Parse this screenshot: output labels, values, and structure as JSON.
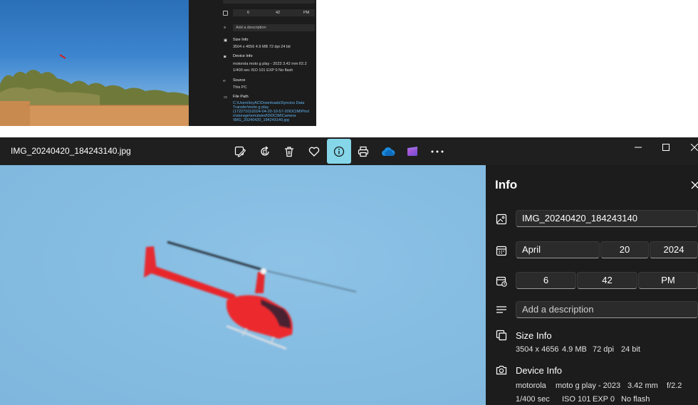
{
  "thumbnail": {
    "time_hour": "6",
    "time_minute": "42",
    "time_ampm": "PM",
    "description_placeholder": "Add a description",
    "size_info_label": "Size Info",
    "size_info_values": "3504 x 4656    4.9 MB    72 dpi    24 bit",
    "device_info_label": "Device Info",
    "device_line1": "motorola    moto g play - 2023    3.42 mm    f/2.2",
    "device_line2": "1/400 sec    ISO 101    EXP 0    No flash",
    "source_label": "Source",
    "source_value": "This PC",
    "file_path_label": "File Path",
    "file_path_line1": "C:\\Users\\loyAC\\Downloads\\Syncios Data",
    "file_path_line2": "Transfer\\moto g play",
    "file_path_line3": "(1722710)\\2024-04-20-10-57-20\\DCIM\\Phot",
    "file_path_line4": "o\\storage\\emulated\\0\\DCIM\\Camera",
    "file_path_line5": "\\IMG_20240420_184243140.jpg"
  },
  "window": {
    "filename": "IMG_20240420_184243140.jpg",
    "toolbar_icons": [
      "edit-image-icon",
      "rotate-icon",
      "delete-icon",
      "favorite-heart-icon",
      "info-icon",
      "print-icon",
      "onedrive-cloud-icon",
      "clipchamp-icon",
      "more-options-icon"
    ],
    "accent_color": "#84d6e8"
  },
  "info": {
    "title": "Info",
    "file_name": "IMG_20240420_184243140",
    "date_month": "April",
    "date_day": "20",
    "date_year": "2024",
    "time_hour": "6",
    "time_minute": "42",
    "time_ampm": "PM",
    "description_placeholder": "Add a description",
    "size_info_label": "Size Info",
    "size": {
      "dimensions": "3504 x 4656",
      "file_size": "4.9 MB",
      "dpi": "72 dpi",
      "bit_depth": "24 bit"
    },
    "device_info_label": "Device Info",
    "device": {
      "make": "motorola",
      "model": "moto g play - 2023",
      "focal_length": "3.42 mm",
      "aperture": "f/2.2",
      "shutter": "1/400 sec",
      "iso": "ISO 101",
      "exposure": "EXP 0",
      "flash": "No flash"
    }
  }
}
